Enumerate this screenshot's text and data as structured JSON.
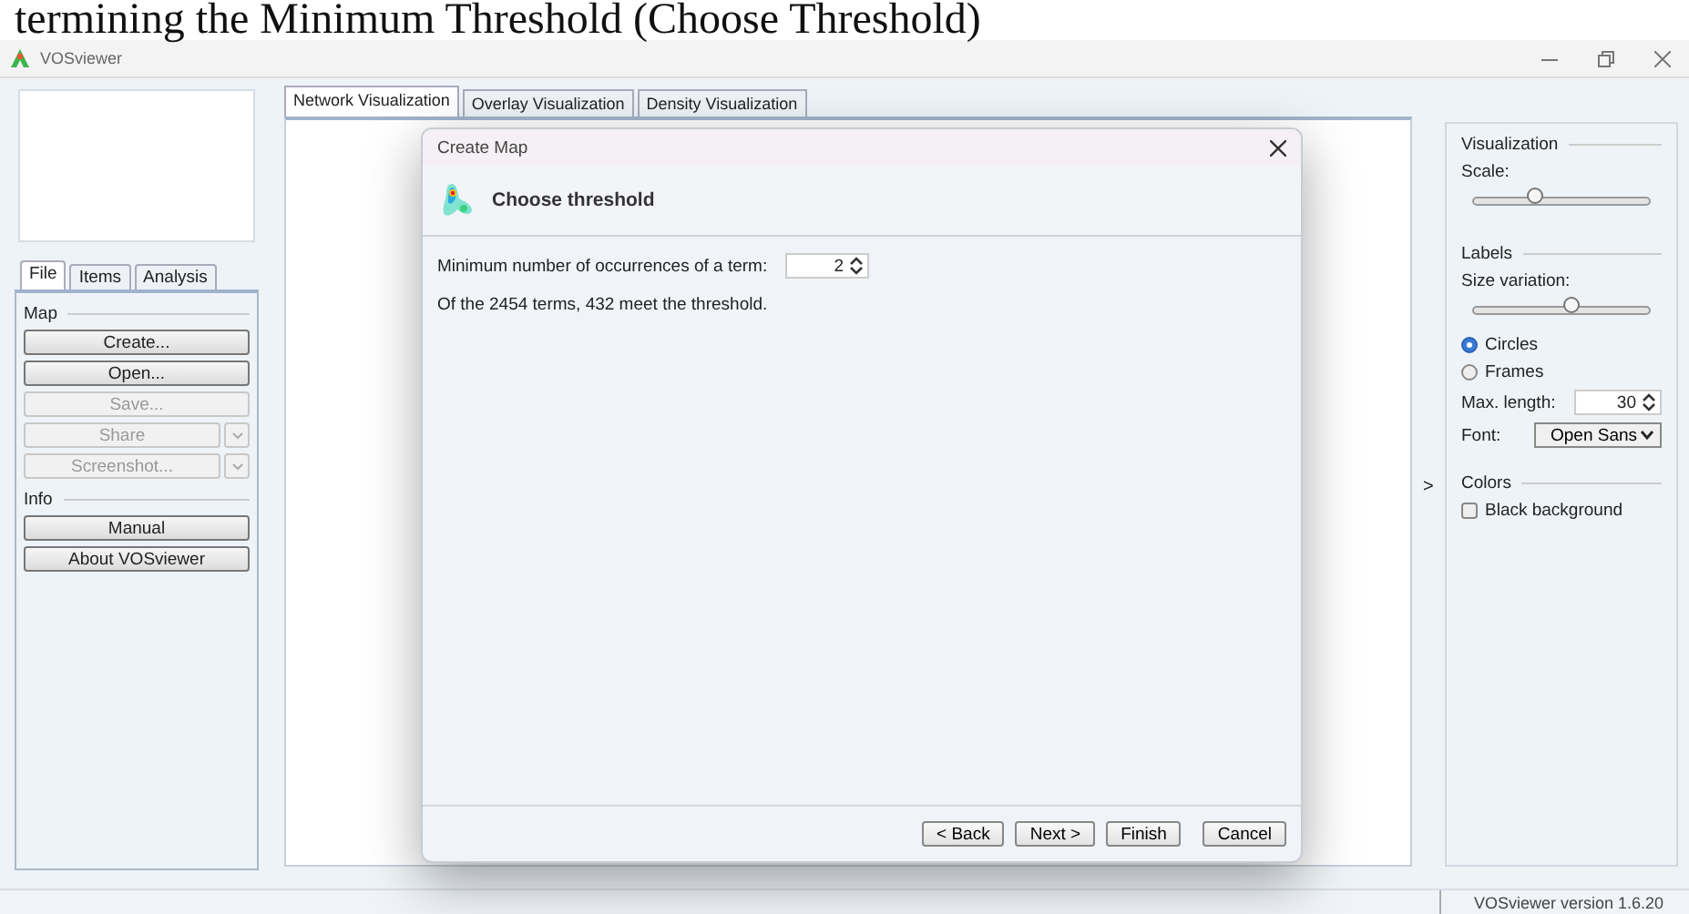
{
  "caption": "termining the Minimum Threshold (Choose Threshold)",
  "window": {
    "title": "VOSviewer"
  },
  "left_panel": {
    "tabs": [
      {
        "label": "File",
        "selected": true
      },
      {
        "label": "Items",
        "selected": false
      },
      {
        "label": "Analysis",
        "selected": false
      }
    ],
    "groups": [
      {
        "title": "Map",
        "buttons": [
          {
            "label": "Create...",
            "kind": "plain",
            "disabled": false
          },
          {
            "label": "Open...",
            "kind": "plain",
            "disabled": false
          },
          {
            "label": "Save...",
            "kind": "plain",
            "disabled": true
          },
          {
            "label": "Share",
            "kind": "split",
            "disabled": true
          },
          {
            "label": "Screenshot...",
            "kind": "split",
            "disabled": true
          }
        ]
      },
      {
        "title": "Info",
        "buttons": [
          {
            "label": "Manual",
            "kind": "plain",
            "disabled": false
          },
          {
            "label": "About VOSviewer",
            "kind": "plain",
            "disabled": false
          }
        ]
      }
    ]
  },
  "view_tabs": [
    {
      "label": "Network Visualization",
      "selected": true
    },
    {
      "label": "Overlay Visualization",
      "selected": false
    },
    {
      "label": "Density Visualization",
      "selected": false
    }
  ],
  "dialog": {
    "title": "Create Map",
    "heading": "Choose threshold",
    "field": {
      "label": "Minimum number of occurrences of a term:",
      "value": "2"
    },
    "message": "Of the 2454 terms, 432 meet the threshold.",
    "buttons": [
      "< Back",
      "Next >",
      "Finish",
      "Cancel"
    ]
  },
  "right_panel": {
    "collapse_toggle": ">",
    "sections": [
      {
        "title": "Visualization",
        "items": [
          {
            "kind": "slider",
            "label": "Scale:",
            "level": 0.35
          }
        ]
      },
      {
        "title": "Labels",
        "items": [
          {
            "kind": "slider",
            "label": "Size variation:",
            "level": 0.55
          },
          {
            "kind": "radio",
            "label": "Circles",
            "selected": true
          },
          {
            "kind": "radio",
            "label": "Frames",
            "selected": false
          },
          {
            "kind": "spinner",
            "label": "Max. length:",
            "value": "30"
          },
          {
            "kind": "select",
            "label": "Font:",
            "value": "Open Sans"
          }
        ]
      },
      {
        "title": "Colors",
        "items": [
          {
            "kind": "checkbox",
            "label": "Black background",
            "checked": false
          }
        ]
      }
    ]
  },
  "status_bar": {
    "version": "VOSviewer version 1.6.20"
  }
}
